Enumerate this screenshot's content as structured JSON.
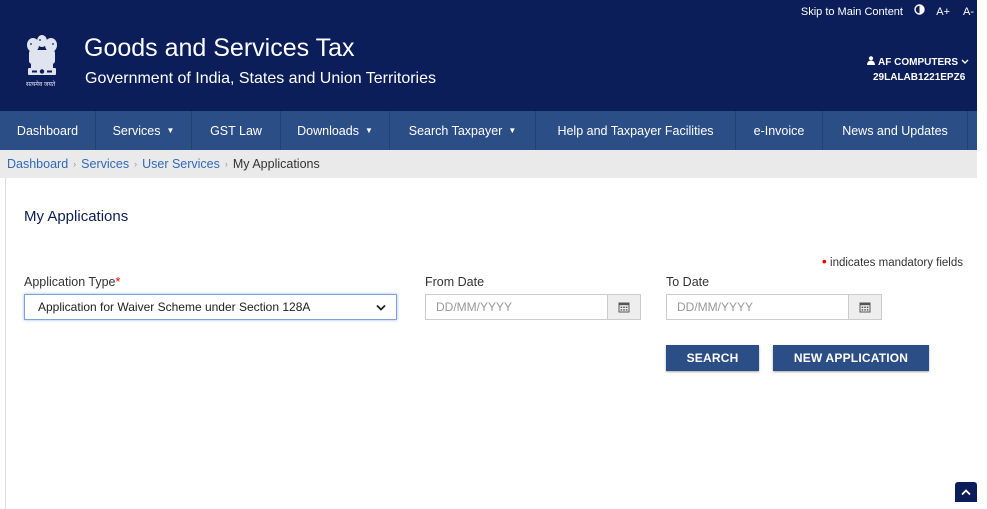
{
  "topbar": {
    "skip_link": "Skip to Main Content",
    "font_increase": "A+",
    "font_decrease": "A-"
  },
  "header": {
    "emblem_caption": "सत्यमेव जयते",
    "title": "Goods and Services Tax",
    "subtitle": "Government of India, States and Union Territories",
    "user_name": "AF COMPUTERS",
    "user_gstin": "29LALAB1221EPZ6"
  },
  "nav": {
    "items": [
      {
        "label": "Dashboard",
        "caret": ""
      },
      {
        "label": "Services",
        "caret": "▼"
      },
      {
        "label": "GST Law",
        "caret": ""
      },
      {
        "label": "Downloads",
        "caret": "▼"
      },
      {
        "label": "Search Taxpayer",
        "caret": "▼"
      },
      {
        "label": "Help and Taxpayer Facilities",
        "caret": ""
      },
      {
        "label": "e-Invoice",
        "caret": ""
      },
      {
        "label": "News and Updates",
        "caret": ""
      }
    ]
  },
  "breadcrumb": {
    "items": [
      "Dashboard",
      "Services",
      "User Services"
    ],
    "current": "My Applications"
  },
  "main": {
    "heading": "My Applications",
    "mandatory_note": "indicates mandatory fields",
    "application_type": {
      "label": "Application Type",
      "value": "Application for Waiver Scheme under Section 128A"
    },
    "from_date": {
      "label": "From Date",
      "placeholder": "DD/MM/YYYY"
    },
    "to_date": {
      "label": "To Date",
      "placeholder": "DD/MM/YYYY"
    },
    "search_button": "SEARCH",
    "new_application_button": "NEW APPLICATION"
  },
  "colors": {
    "header_bg": "#0b1e59",
    "nav_bg": "#2c4e86",
    "link": "#2f69b8",
    "required": "#e00000"
  }
}
